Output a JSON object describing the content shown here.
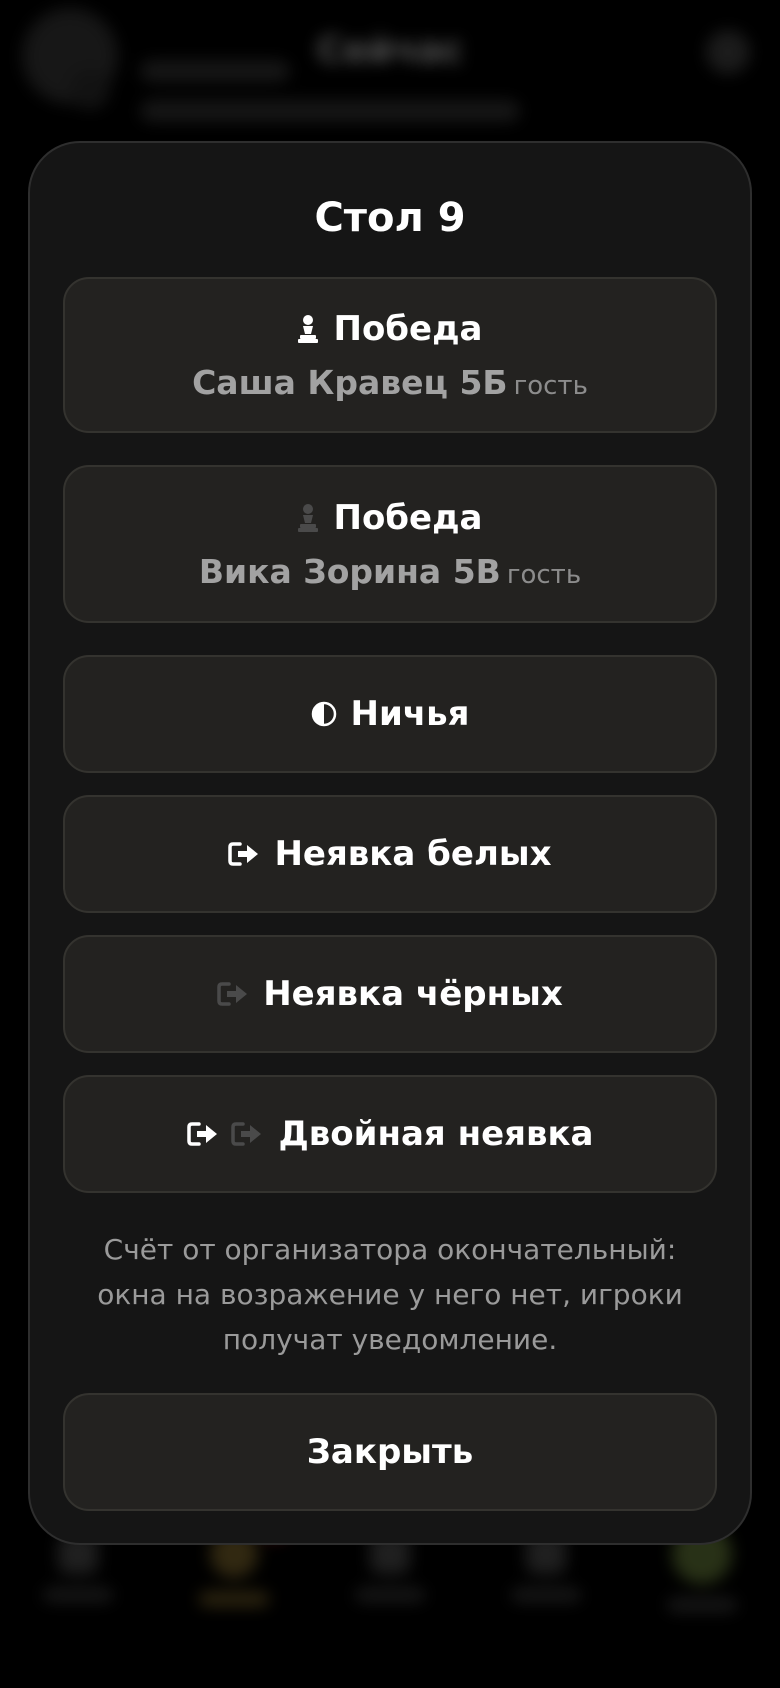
{
  "background": {
    "title": "Сейчас"
  },
  "modal": {
    "title": "Стол 9",
    "options": [
      {
        "label": "Победа",
        "player": "Саша Кравец 5Б",
        "tag": "гость",
        "icon": "white-pawn-icon"
      },
      {
        "label": "Победа",
        "player": "Вика Зорина 5В",
        "tag": "гость",
        "icon": "black-pawn-icon"
      },
      {
        "label": "Ничья",
        "icon": "half-circle-icon"
      },
      {
        "label": "Неявка белых",
        "icon": "exit-white-icon"
      },
      {
        "label": "Неявка чёрных",
        "icon": "exit-black-icon"
      },
      {
        "label": "Двойная неявка",
        "icon": "exit-both-icon"
      }
    ],
    "note": "Счёт от организатора окончательный: окна на возражение у него нет, игроки получат уведомление.",
    "close_label": "Закрыть"
  },
  "colors": {
    "sheet_bg": "#151515",
    "button_bg": "#232220",
    "text_primary": "#ffffff",
    "text_secondary": "#a2a2a2"
  }
}
